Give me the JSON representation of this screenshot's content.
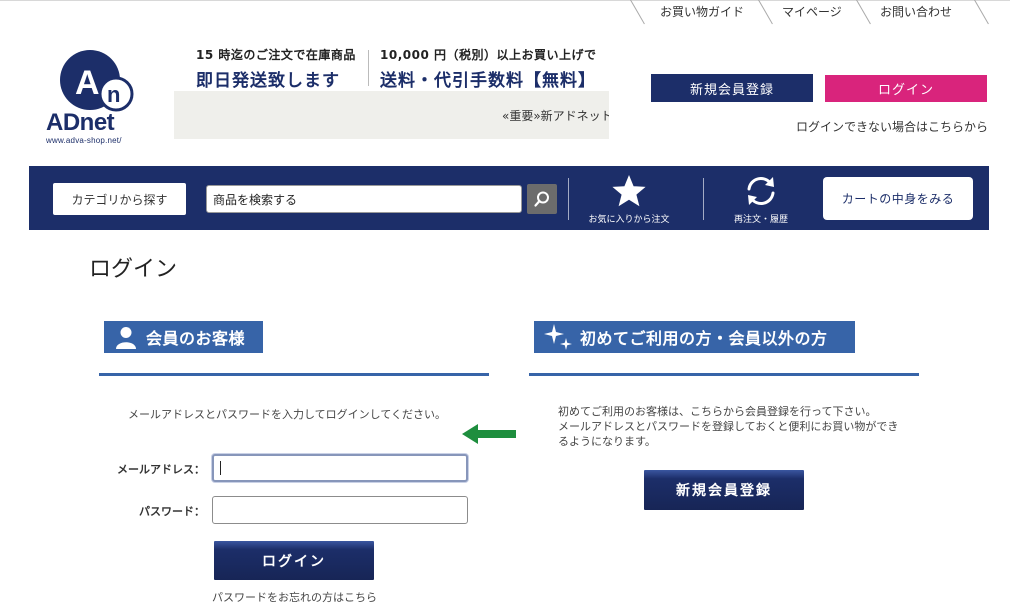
{
  "top_nav": {
    "items": [
      "お買い物ガイド",
      "マイページ",
      "お問い合わせ"
    ]
  },
  "logo": {
    "mark": "An",
    "name": "ADnet",
    "url": "www.adva-shop.net/"
  },
  "promo": {
    "line1_small": "15 時迄のご注文で在庫商品",
    "line1_big": "即日発送致します",
    "line2_small": "10,000 円（税別）以上お買い上げで",
    "line2_big": "送料・代引手数料【無料】"
  },
  "notice": {
    "text": "«重要»新アドネット"
  },
  "header": {
    "register_label": "新規会員登録",
    "login_label": "ログイン",
    "forgot_login": "ログインできない場合はこちらから"
  },
  "navbar": {
    "category_label": "カテゴリから探す",
    "search_value": "商品を検索する",
    "favorites_label": "お気に入りから注文",
    "reorder_label": "再注文・履歴",
    "cart_label": "カートの中身をみる"
  },
  "page": {
    "title": "ログイン"
  },
  "member": {
    "heading": "会員のお客様",
    "instruction": "メールアドレスとパスワードを入力してログインしてください。",
    "email_label": "メールアドレス：",
    "email_value": "",
    "password_label": "パスワード：",
    "password_value": "",
    "login_button": "ログイン",
    "forgot_password": "パスワードをお忘れの方はこちら"
  },
  "guest": {
    "heading": "初めてご利用の方・会員以外の方",
    "text": "初めてご利用のお客様は、こちらから会員登録を行って下さい。\nメールアドレスとパスワードを登録しておくと便利にお買い物ができるようになります。",
    "register_button": "新規会員登録"
  },
  "colors": {
    "navy": "#1c2e69",
    "pink": "#d9247c",
    "section_blue": "#3764a8",
    "hint_arrow": "#1e8e3e"
  }
}
